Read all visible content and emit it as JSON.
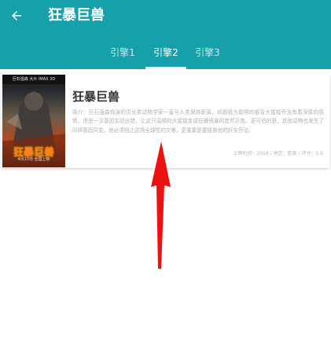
{
  "app_bar": {
    "title": "狂暴巨兽",
    "back_icon": "arrow-left-icon",
    "background_color": "#16a0aa"
  },
  "tabs": [
    {
      "label": "引擎1",
      "selected": false
    },
    {
      "label": "引擎2",
      "selected": true
    },
    {
      "label": "引擎3",
      "selected": false
    }
  ],
  "results": [
    {
      "title": "狂暴巨兽",
      "description": "简介：巨石强森饰演的灵长类动物学家一直与人类保持距离，却跟极为聪明的银背大猩猩乔治有着深厚的感情。但是一次基因实验出错，让这只温顺的大猩猩变成狂躁残暴的庞然巨兽。更可怕的是，其他动物也发生了同样基因异变。他必须阻止这场全球性的灾难，更重要是要拯救他的好友乔治。",
      "meta": "上映时间：2018 / 地区：欧美 / 评分：5.9",
      "poster": {
        "title_text": "狂暴巨兽",
        "subtitle_text": "4月13日 全国上映",
        "top_text": "巨石强森 大片 IMAX 3D"
      }
    }
  ],
  "annotation": {
    "icon": "red-arrow-annotation",
    "color": "#ee1111"
  }
}
